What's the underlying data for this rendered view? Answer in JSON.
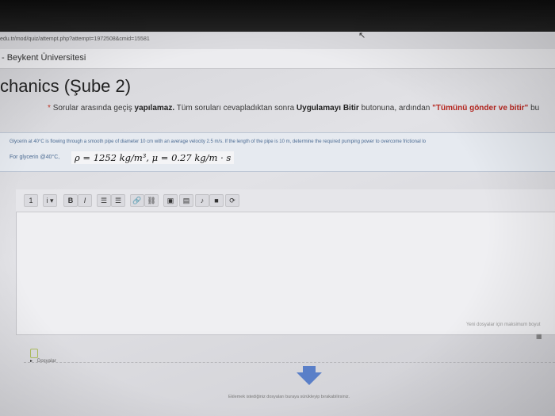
{
  "browser": {
    "url": "edu.tr/mod/quiz/attempt.php?attempt=1972508&cmid=15581"
  },
  "site": {
    "name": "- Beykent Üniversitesi"
  },
  "course": {
    "title": "chanics (Şube 2)"
  },
  "notice": {
    "star": "*",
    "part1": "Sorular arasında geçiş ",
    "part2": "yapılamaz.",
    "part3": " Tüm soruları cevapladıktan sonra ",
    "part4": "Uygulamayı Bitir",
    "part5": " butonuna, ardından ",
    "part6": "\"Tümünü gönder ve bitir\"",
    "part7": " bu"
  },
  "question": {
    "text": "Glycerin at 40°C is flowing through a smooth pipe of diameter 10 cm with an average velocity 2.5 m/s. If the length of the pipe is 10 m, determine the required pumping power to overcome frictional lo",
    "given_label": "For glycerin @40°C,",
    "formula": "ρ = 1252 kg/m³, μ = 0.27 kg/m · s"
  },
  "editor": {
    "toolbar": [
      "1",
      "i ▾",
      "B",
      "I",
      "☰",
      "☰",
      "🔗",
      "⛓",
      "▣",
      "▤",
      "♪",
      "■",
      "⟳"
    ],
    "answer": "",
    "max_size_note": "Yeni dosyalar için maksimum boyut",
    "grid_icon": "grid-view-icon"
  },
  "files": {
    "label": "Dosyalar",
    "drop_hint": "Eklemek istediğiniz dosyaları buraya sürükleyip bırakabilirsiniz."
  }
}
